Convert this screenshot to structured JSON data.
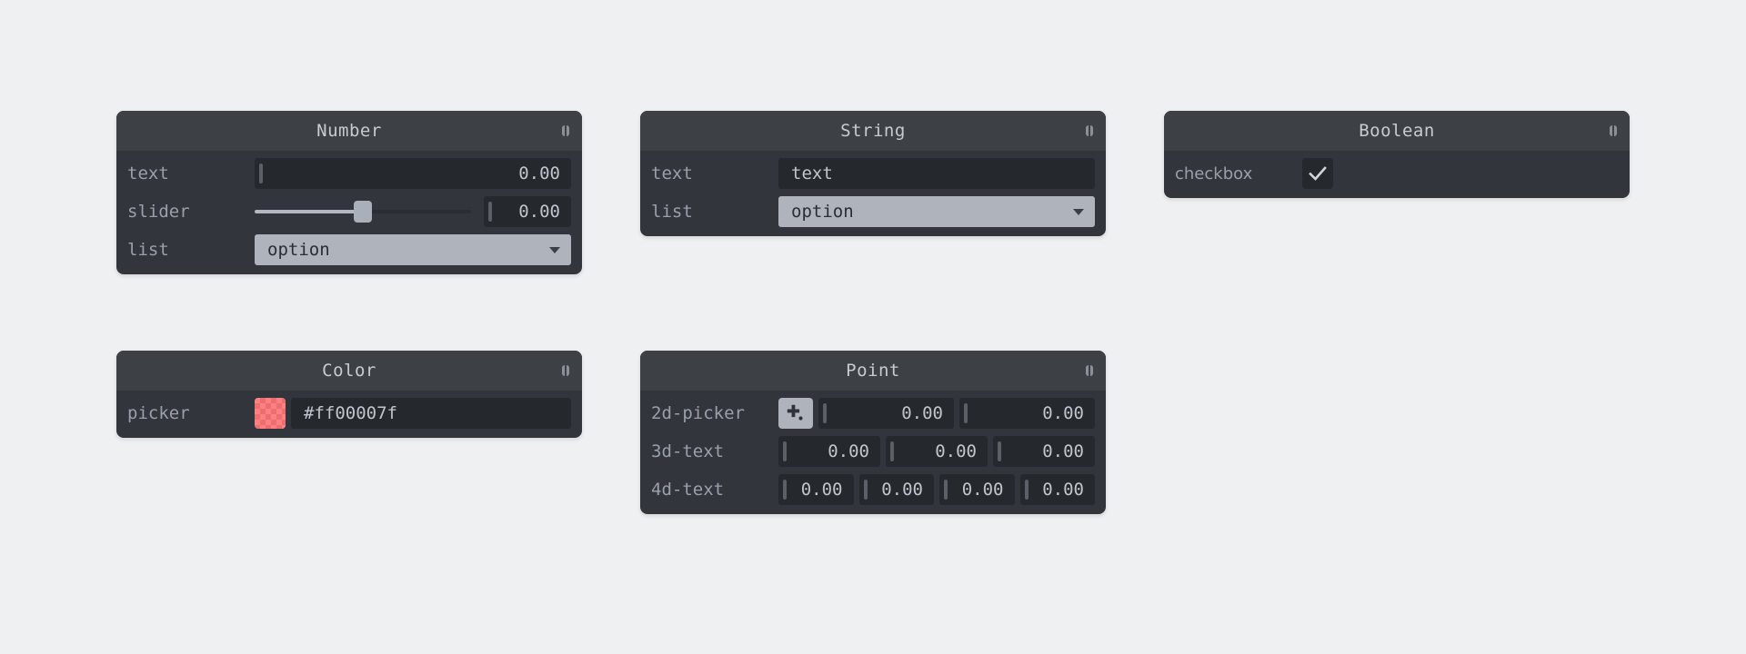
{
  "theme": {
    "page_background": "#eff0f2",
    "panel_background": "#32363c",
    "panel_header_background": "#3d4146",
    "field_background": "#25282d",
    "accent_light": "#aeb3bc",
    "label_color": "#9aa0a8",
    "value_color": "#c2c6cc"
  },
  "panels": {
    "number": {
      "title": "Number",
      "grip_icon": "grip-icon",
      "rows": {
        "text": {
          "label": "text",
          "value": "0.00"
        },
        "slider": {
          "label": "slider",
          "value": "0.00",
          "percent": 50
        },
        "list": {
          "label": "list",
          "selected": "option",
          "caret_icon": "chevron-down-icon"
        }
      }
    },
    "string": {
      "title": "String",
      "grip_icon": "grip-icon",
      "rows": {
        "text": {
          "label": "text",
          "value": "text"
        },
        "list": {
          "label": "list",
          "selected": "option",
          "caret_icon": "chevron-down-icon"
        }
      }
    },
    "boolean": {
      "title": "Boolean",
      "grip_icon": "grip-icon",
      "rows": {
        "checkbox": {
          "label": "checkbox",
          "checked": true,
          "check_icon": "check-icon"
        }
      }
    },
    "color": {
      "title": "Color",
      "grip_icon": "grip-icon",
      "rows": {
        "picker": {
          "label": "picker",
          "value": "#ff00007f",
          "swatch_color": "rgba(255,0,0,0.498)",
          "swatch_icon": "color-swatch"
        }
      }
    },
    "point": {
      "title": "Point",
      "grip_icon": "grip-icon",
      "rows": {
        "picker2d": {
          "label": "2d-picker",
          "button_icon": "point-picker-icon",
          "x": "0.00",
          "y": "0.00"
        },
        "text3d": {
          "label": "3d-text",
          "x": "0.00",
          "y": "0.00",
          "z": "0.00"
        },
        "text4d": {
          "label": "4d-text",
          "x": "0.00",
          "y": "0.00",
          "z": "0.00",
          "w": "0.00"
        }
      }
    }
  }
}
